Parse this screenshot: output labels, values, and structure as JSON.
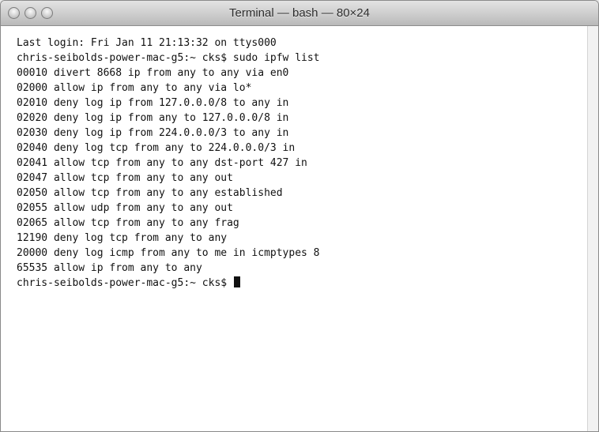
{
  "window": {
    "title": "Terminal — bash — 80×24"
  },
  "terminal": {
    "lines": [
      "Last login: Fri Jan 11 21:13:32 on ttys000",
      "chris-seibolds-power-mac-g5:~ cks$ sudo ipfw list",
      "00010 divert 8668 ip from any to any via en0",
      "02000 allow ip from any to any via lo*",
      "02010 deny log ip from 127.0.0.0/8 to any in",
      "02020 deny log ip from any to 127.0.0.0/8 in",
      "02030 deny log ip from 224.0.0.0/3 to any in",
      "02040 deny log tcp from any to 224.0.0.0/3 in",
      "02041 allow tcp from any to any dst-port 427 in",
      "02047 allow tcp from any to any out",
      "02050 allow tcp from any to any established",
      "02055 allow udp from any to any out",
      "02065 allow tcp from any to any frag",
      "12190 deny log tcp from any to any",
      "20000 deny log icmp from any to me in icmptypes 8",
      "65535 allow ip from any to any"
    ],
    "prompt": "chris-seibolds-power-mac-g5:~ cks$ "
  },
  "colors": {
    "text": "#111111",
    "background": "#ffffff",
    "titlebar": "#cfcfcf"
  },
  "icons": [
    "close-icon",
    "minimize-icon",
    "zoom-icon",
    "cursor"
  ]
}
